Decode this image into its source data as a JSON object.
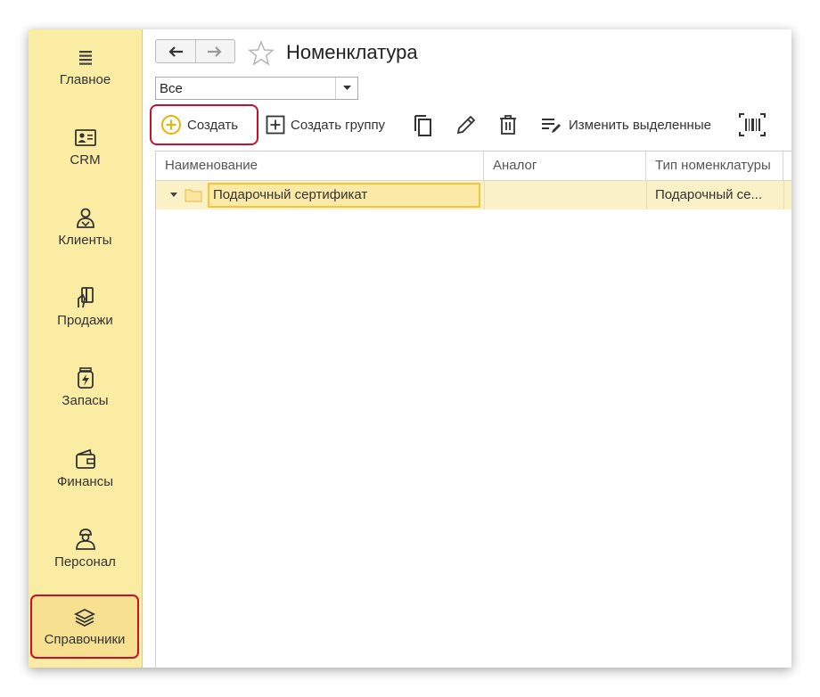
{
  "sidebar": {
    "items": [
      {
        "label": "Главное",
        "icon": "menu-lines-icon"
      },
      {
        "label": "CRM",
        "icon": "contact-card-icon"
      },
      {
        "label": "Клиенты",
        "icon": "person-icon"
      },
      {
        "label": "Продажи",
        "icon": "card-hand-icon"
      },
      {
        "label": "Запасы",
        "icon": "jar-icon"
      },
      {
        "label": "Финансы",
        "icon": "wallet-icon"
      },
      {
        "label": "Персонал",
        "icon": "worker-icon"
      },
      {
        "label": "Справочники",
        "icon": "stack-icon"
      }
    ],
    "active": "Справочники"
  },
  "header": {
    "title": "Номенклатура",
    "back_icon": "arrow-left-icon",
    "forward_icon": "arrow-right-icon",
    "favorite_icon": "star-icon"
  },
  "filter": {
    "selected": "Все"
  },
  "toolbar": {
    "create_label": "Создать",
    "create_group_label": "Создать группу",
    "edit_selected_label": "Изменить выделенные"
  },
  "table": {
    "columns": [
      "Наименование",
      "Аналог",
      "Тип номенклатуры"
    ],
    "rows": [
      {
        "name": "Подарочный сертификат",
        "analog": "",
        "type": "Подарочный се..."
      }
    ]
  },
  "colors": {
    "sidebar_bg": "#fbeca4",
    "highlight_border": "#c8102e",
    "row_selected": "#fbf1c7",
    "create_icon": "#e8b600"
  }
}
